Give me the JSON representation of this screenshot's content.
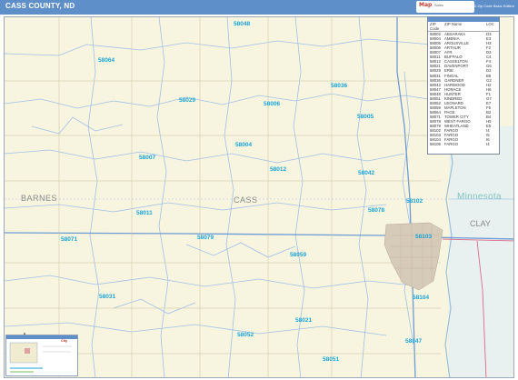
{
  "title": "CASS COUNTY, ND",
  "brand": {
    "logo": "Map",
    "sub": "Sales",
    "edition": "ND Zip Code Basic Edition"
  },
  "counties": [
    {
      "id": "barnes",
      "text": "BARNES"
    },
    {
      "id": "cass",
      "text": "CASS"
    },
    {
      "id": "clay",
      "text": "CLAY"
    }
  ],
  "state_label": "Minnesota",
  "zip_labels": [
    "58048",
    "58064",
    "58029",
    "58006",
    "58036",
    "58005",
    "58004",
    "58007",
    "58012",
    "58042",
    "58011",
    "58079",
    "58078",
    "58102",
    "58071",
    "58103",
    "58059",
    "58031",
    "58104",
    "58021",
    "58052",
    "58051",
    "58047"
  ],
  "legend": {
    "headers": [
      "ZIP Code",
      "ZIP Name",
      "LOC"
    ],
    "rows": [
      [
        "58002",
        "ABSARAKA",
        "D3"
      ],
      [
        "58004",
        "AMENIA",
        "E3"
      ],
      [
        "58005",
        "ARGUSVILLE",
        "H3"
      ],
      [
        "58006",
        "ARTHUR",
        "F2"
      ],
      [
        "58007",
        "AYR",
        "D3"
      ],
      [
        "58011",
        "BUFFALO",
        "C4"
      ],
      [
        "58012",
        "CASSELTON",
        "F4"
      ],
      [
        "58021",
        "DAVENPORT",
        "G6"
      ],
      [
        "58029",
        "ERIE",
        "D2"
      ],
      [
        "58031",
        "FINGAL",
        "B6"
      ],
      [
        "58036",
        "GARDNER",
        "G2"
      ],
      [
        "58042",
        "HARWOOD",
        "H2"
      ],
      [
        "58047",
        "HORACE",
        "H6"
      ],
      [
        "58048",
        "HUNTER",
        "F1"
      ],
      [
        "58051",
        "KINDRED",
        "G7"
      ],
      [
        "58052",
        "LEONARD",
        "E7"
      ],
      [
        "58059",
        "MAPLETON",
        "F5"
      ],
      [
        "58064",
        "PAGE",
        "B2"
      ],
      [
        "58071",
        "TOWER CITY",
        "B4"
      ],
      [
        "58078",
        "WEST FARGO",
        "H5"
      ],
      [
        "58079",
        "WHEATLAND",
        "E5"
      ],
      [
        "58102",
        "FARGO",
        "I4"
      ],
      [
        "58103",
        "FARGO",
        "I5"
      ],
      [
        "58104",
        "FARGO",
        "I6"
      ],
      [
        "58105",
        "FARGO",
        "I4"
      ]
    ]
  },
  "inset": {
    "brand": "City"
  },
  "colors": {
    "header": "#5f8fc9",
    "land": "#f7f5df",
    "zip": "#1aa3d9",
    "boundary": "#9bb8e2",
    "road": "#7aa3d6",
    "urban": "#c9b8a4"
  }
}
